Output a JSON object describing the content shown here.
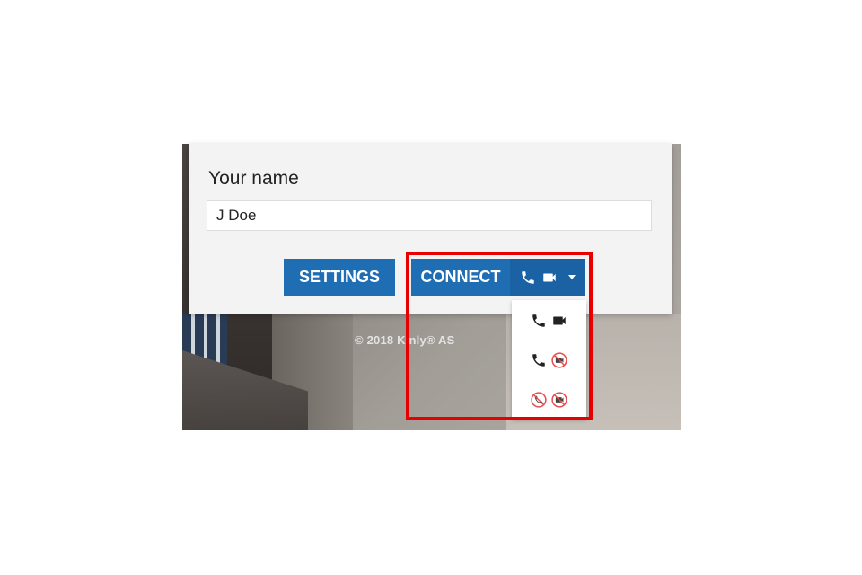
{
  "form": {
    "name_label": "Your name",
    "name_value": "J Doe",
    "settings_label": "SETTINGS",
    "connect_label": "CONNECT"
  },
  "footer": {
    "copyright": "© 2018 Kinly® AS"
  },
  "connect_options": [
    {
      "audio": "phone-icon",
      "video": "camera-icon"
    },
    {
      "audio": "phone-icon",
      "video": "camera-off-icon"
    },
    {
      "audio": "phone-off-icon",
      "video": "camera-off-icon"
    }
  ],
  "colors": {
    "primary": "#1f6db3",
    "highlight": "#e80000",
    "muted_icon": "#e94c4c"
  }
}
